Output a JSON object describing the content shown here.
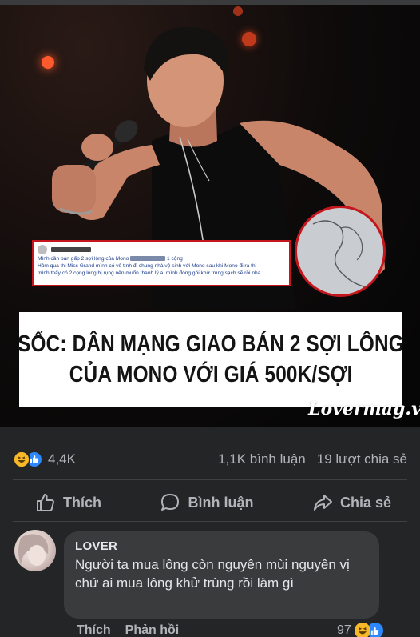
{
  "post": {
    "image": {
      "screenshot_lines": [
        "Mình cần bán gấp 2 sợi lông của Mono",
        "1 cộng",
        "Hôm qua thi Miss Grand mình có vô tình đi chung nhà vệ sinh với Mono sau khi Mono đi ra thì",
        "mình thấy có 2 cọng lông bị rụng nên muốn thanh lý a, mình đóng gói khử trùng sạch sẽ rồi nha"
      ],
      "headline_line1": "SỐC: DÂN MẠNG GIAO BÁN 2 SỢI LÔNG",
      "headline_line2": "CỦA MONO VỚI GIÁ 500K/SỢI",
      "watermark": "Lovermag.vn"
    },
    "stats": {
      "reaction_count": "4,4K",
      "comments": "1,1K bình luận",
      "shares": "19 lượt chia sẻ"
    },
    "actions": {
      "like": "Thích",
      "comment": "Bình luận",
      "share": "Chia sẻ"
    }
  },
  "comment": {
    "author": "LOVER",
    "text": "Người ta mua lông còn nguyên mùi nguyên vị chứ ai mua lông khử trùng rồi làm gì",
    "like": "Thích",
    "reply": "Phản hồi",
    "reaction_count": "97"
  },
  "colors": {
    "background": "#242526",
    "bubble": "#3a3b3c",
    "secondary_text": "#b0b3b8",
    "primary_text": "#e4e6eb",
    "like_blue": "#2d88ff",
    "haha_yellow": "#f7b928",
    "headline_border_red": "#c4161c"
  },
  "icons": [
    "haha-emoji-icon",
    "like-emoji-icon",
    "thumbs-up-icon",
    "comment-bubble-icon",
    "share-arrow-icon"
  ]
}
